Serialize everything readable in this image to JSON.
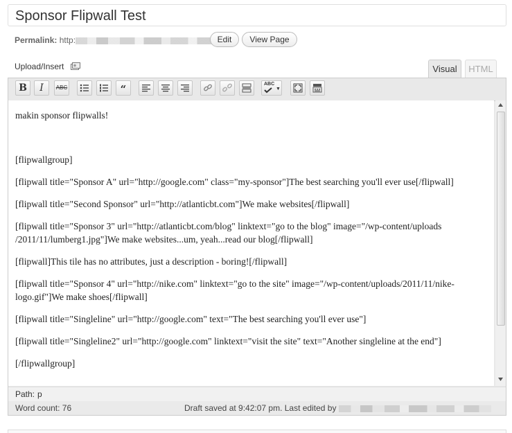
{
  "post": {
    "title": "Sponsor Flipwall Test"
  },
  "permalink": {
    "label": "Permalink:",
    "prefix": "http:"
  },
  "buttons": {
    "edit": "Edit",
    "view_page": "View Page"
  },
  "media": {
    "upload_label": "Upload/Insert",
    "icon": "media-icon"
  },
  "tabs": {
    "visual": "Visual",
    "html": "HTML",
    "active": "Visual"
  },
  "toolbar": [
    {
      "name": "bold-button",
      "glyph": "B"
    },
    {
      "name": "italic-button",
      "glyph": "I"
    },
    {
      "name": "strikethrough-button",
      "glyph": "ABC"
    },
    {
      "name": "bullet-list-button",
      "glyph": ""
    },
    {
      "name": "numbered-list-button",
      "glyph": ""
    },
    {
      "name": "blockquote-button",
      "glyph": "66"
    },
    {
      "name": "align-left-button",
      "glyph": ""
    },
    {
      "name": "align-center-button",
      "glyph": ""
    },
    {
      "name": "align-right-button",
      "glyph": ""
    },
    {
      "name": "insert-link-button",
      "glyph": ""
    },
    {
      "name": "unlink-button",
      "glyph": ""
    },
    {
      "name": "insert-more-button",
      "glyph": ""
    },
    {
      "name": "spellcheck-button",
      "glyph": "ABC"
    },
    {
      "name": "fullscreen-button",
      "glyph": ""
    },
    {
      "name": "kitchen-sink-button",
      "glyph": ""
    }
  ],
  "content": {
    "lines": [
      "makin sponsor flipwalls!",
      "[flipwallgroup]",
      "[flipwall title=\"Sponsor A\" url=\"http://google.com\" class=\"my-sponsor\"]The best searching you'll ever use[/flipwall]",
      "[flipwall title=\"Second Sponsor\" url=\"http://atlanticbt.com\"]We make websites[/flipwall]",
      "[flipwall title=\"Sponsor 3\" url=\"http://atlanticbt.com/blog\" linktext=\"go to the blog\" image=\"/wp-content/uploads",
      "/2011/11/lumberg1.jpg\"]We make websites...um, yeah...read our blog[/flipwall]",
      "[flipwall]This tile has no attributes, just a description - boring![/flipwall]",
      "[flipwall title=\"Sponsor 4\" url=\"http://nike.com\" linktext=\"go to the site\" image=\"/wp-content/uploads/2011/11/nike-",
      "logo.gif\"]We make shoes[/flipwall]",
      "[flipwall title=\"Singleline\" url=\"http://google.com\" text=\"The best searching you'll ever use\"]",
      "[flipwall title=\"Singleline2\" url=\"http://google.com\" linktext=\"visit the site\" text=\"Another singleline at the end\"]",
      "[/flipwallgroup]"
    ]
  },
  "path": {
    "label": "Path:",
    "value": "p"
  },
  "status": {
    "word_count": "Word count: 76",
    "draft": "Draft saved at 9:42:07 pm. Last edited by"
  }
}
